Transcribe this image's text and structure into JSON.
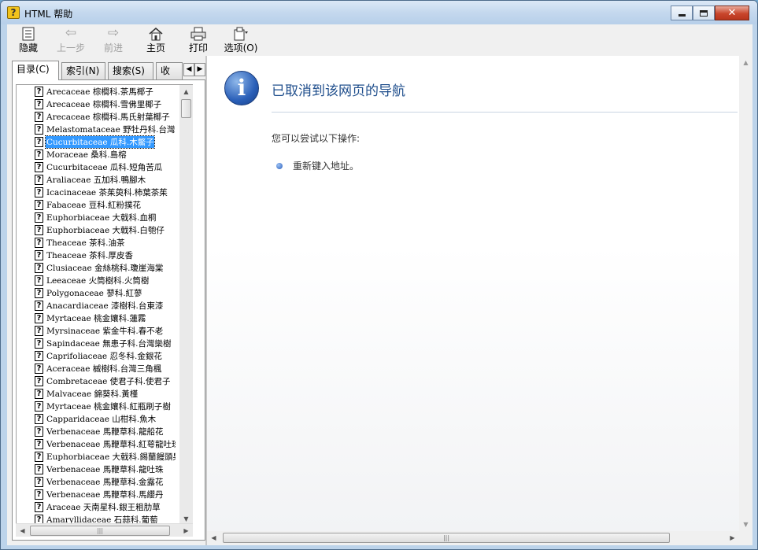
{
  "window": {
    "title": "HTML 帮助",
    "icon": "help-icon",
    "controls": {
      "minimize": "minimize",
      "maximize": "maximize",
      "close": "✕"
    }
  },
  "toolbar": {
    "buttons": [
      {
        "label": "隐藏",
        "icon": "hide-pane-icon",
        "enabled": true
      },
      {
        "label": "上一步",
        "icon": "back-arrow-icon",
        "enabled": false
      },
      {
        "label": "前进",
        "icon": "forward-arrow-icon",
        "enabled": false
      },
      {
        "label": "主页",
        "icon": "home-icon",
        "enabled": true
      },
      {
        "label": "打印",
        "icon": "printer-icon",
        "enabled": true
      },
      {
        "label": "选项(O)",
        "icon": "options-icon",
        "enabled": true
      }
    ]
  },
  "tabs": [
    {
      "label": "目录(C)",
      "active": true
    },
    {
      "label": "索引(N)",
      "active": false
    },
    {
      "label": "搜索(S)",
      "active": false
    },
    {
      "label": "收",
      "active": false
    }
  ],
  "tree": {
    "items": [
      "Arecaceae 棕櫚科.茶馬椰子",
      "Arecaceae 棕櫚科.雪佛里椰子",
      "Arecaceae 棕櫚科.馬氏射葉椰子",
      "Melastomataceae 野牡丹科.台灣",
      "Cucurbitaceae 瓜科.木鱉子",
      "Moraceae 桑科.島榕",
      "Cucurbitaceae 瓜科.短角苦瓜",
      "Araliaceae 五加科.鴨腳木",
      "Icacinaceae 茶茱萸科.柿葉茶茱",
      "Fabaceae 豆科.紅粉撲花",
      "Euphorbiaceae 大戟科.血桐",
      "Euphorbiaceae 大戟科.白匏仔",
      "Theaceae 茶科.油茶",
      "Theaceae 茶科.厚皮香",
      "Clusiaceae 金絲桃科.瓊崖海棠",
      "Leeaceae 火筒樹科.火筒樹",
      "Polygonaceae 蓼科.紅蓼",
      "Anacardiaceae 漆樹科.台東漆",
      "Myrtaceae 桃金孃科.蓮霧",
      "Myrsinaceae 紫金牛科.春不老",
      "Sapindaceae 無患子科.台灣欒樹",
      "Caprifoliaceae 忍冬科.金銀花",
      "Aceraceae 槭樹科.台灣三角楓",
      "Combretaceae 使君子科.使君子",
      "Malvaceae 錦葵科.黃槿",
      "Myrtaceae 桃金孃科.紅瓶刷子樹",
      "Capparidaceae 山柑科.魚木",
      "Verbenaceae 馬鞭草科.龍船花",
      "Verbenaceae 馬鞭草科.紅萼龍吐珠",
      "Euphorbiaceae 大戟科.錫蘭饅頭果",
      "Verbenaceae 馬鞭草科.龍吐珠",
      "Verbenaceae 馬鞭草科.金露花",
      "Verbenaceae 馬鞭草科.馬纓丹",
      "Araceae 天南星科.銀王粗肋草",
      "Amaryllidaceae 石蒜科.葡萄"
    ],
    "selected_index": 4
  },
  "content": {
    "title": "已取消到该网页的导航",
    "subtitle": "您可以尝试以下操作:",
    "suggestion": "重新键入地址。",
    "icon": "info-icon",
    "accent_color": "#1f4e8c"
  }
}
